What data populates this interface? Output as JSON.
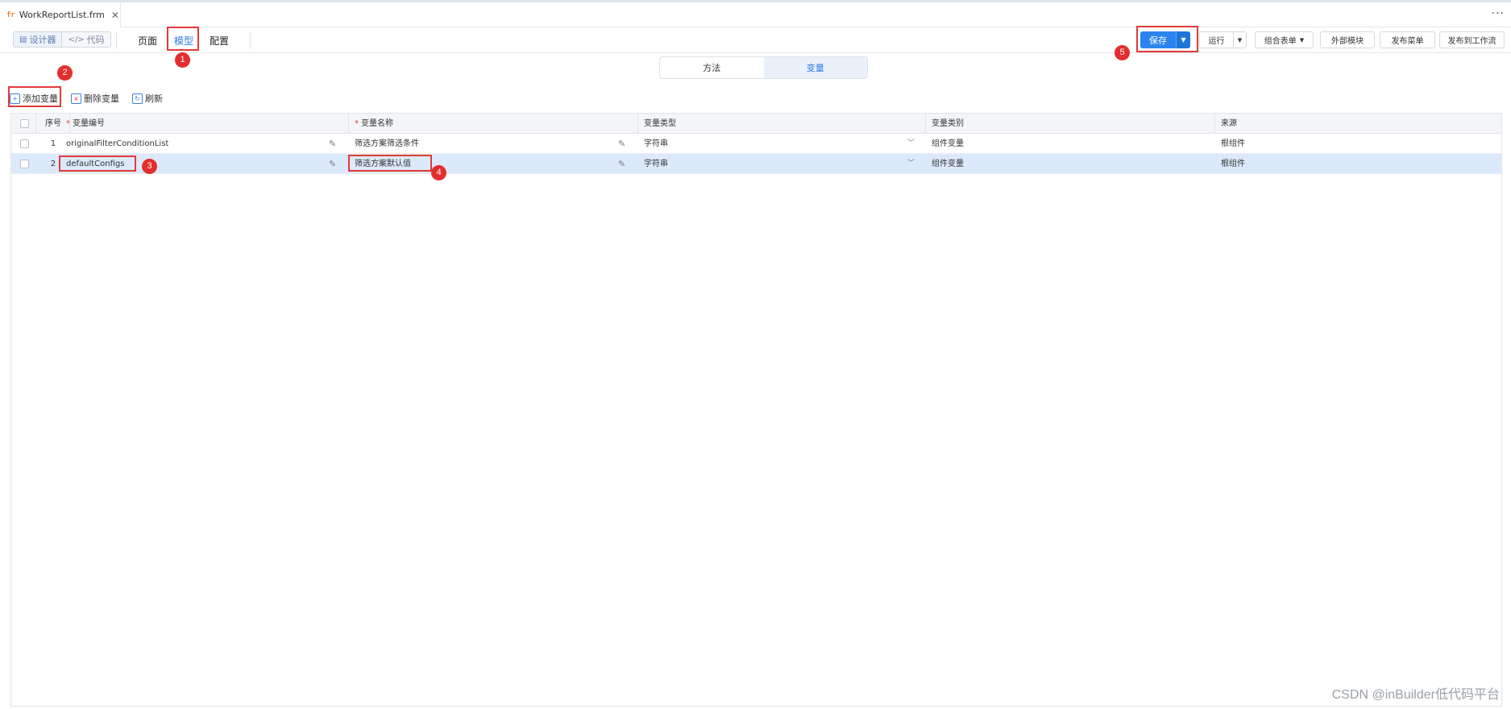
{
  "file_tab": {
    "icon": "fr",
    "name": "WorkReportList.frm",
    "close": "✕"
  },
  "more": "···",
  "view_switch": {
    "designer": "设计器",
    "code": "代码"
  },
  "main_tabs": [
    "页面",
    "模型",
    "配置"
  ],
  "right_buttons": {
    "save": "保存",
    "run": "运行",
    "combo_form": "组合表单",
    "external_module": "外部模块",
    "publish_menu": "发布菜单",
    "publish_workflow": "发布到工作流"
  },
  "segments": [
    "方法",
    "变量"
  ],
  "actions": [
    "添加变量",
    "删除变量",
    "刷新"
  ],
  "table": {
    "headers": [
      "序号",
      "变量编号",
      "变量名称",
      "变量类型",
      "变量类别",
      "来源"
    ],
    "rows": [
      {
        "index": "1",
        "code": "originalFilterConditionList",
        "name": "筛选方案筛选条件",
        "type": "字符串",
        "category": "组件变量",
        "source": "根组件"
      },
      {
        "index": "2",
        "code": "defaultConfigs",
        "name": "筛选方案默认值",
        "type": "字符串",
        "category": "组件变量",
        "source": "根组件"
      }
    ]
  },
  "badges": [
    "1",
    "2",
    "3",
    "4",
    "5"
  ],
  "watermark": "CSDN @inBuilder低代码平台"
}
